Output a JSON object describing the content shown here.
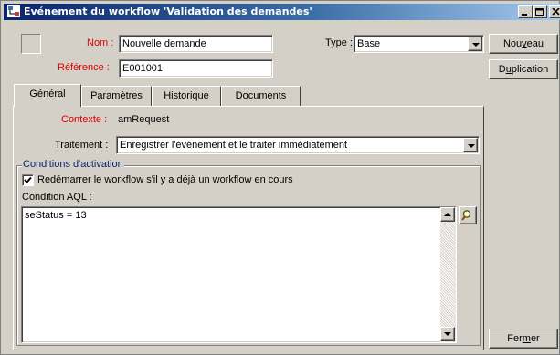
{
  "window": {
    "title": "Evénement du workflow 'Validation des demandes'"
  },
  "header": {
    "nom_label": "Nom :",
    "nom_value": "Nouvelle demande",
    "reference_label": "Référence :",
    "reference_value": "E001001",
    "type_label": "Type :",
    "type_value": "Base"
  },
  "side_buttons": {
    "new_pre": "Nou",
    "new_acc": "v",
    "new_post": "eau",
    "dup_pre": "D",
    "dup_acc": "u",
    "dup_post": "plication",
    "close_pre": "Fer",
    "close_acc": "m",
    "close_post": "er"
  },
  "tabs": [
    {
      "label": "Général"
    },
    {
      "label": "Paramètres"
    },
    {
      "label": "Historique"
    },
    {
      "label": "Documents"
    }
  ],
  "general": {
    "contexte_label": "Contexte :",
    "contexte_value": "amRequest",
    "traitement_label": "Traitement :",
    "traitement_value": "Enregistrer l'événement et le traiter immédiatement",
    "group_title": "Conditions d'activation",
    "restart_checkbox_label": "Redémarrer le workflow s'il y a déjà un workflow en cours",
    "restart_checked": true,
    "aql_label": "Condition AQL :",
    "aql_text": "seStatus = 13"
  },
  "icons": {
    "window_icon": "workflow-app-icon",
    "zoom_button_icon": "magnifier-icon"
  },
  "colors": {
    "titlebar_start": "#0a246a",
    "titlebar_end": "#a6caf0",
    "mandatory_label": "#e00000",
    "group_label": "#0a246a"
  }
}
